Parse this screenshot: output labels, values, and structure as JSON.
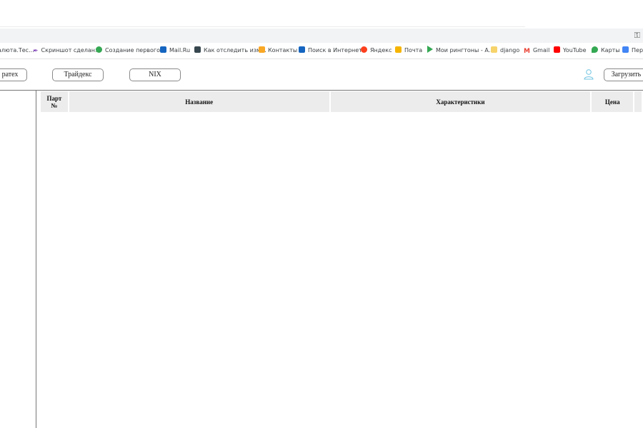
{
  "browser": {
    "bookmarks": [
      {
        "label": "алюта.Тес...",
        "icon": "generic-page-icon",
        "color": "#9aa0a6"
      },
      {
        "label": "Скриншот сделан...",
        "icon": "feather-icon",
        "color": "#7b3fb5"
      },
      {
        "label": "Создание первого...",
        "icon": "green-circle-icon",
        "color": "#34a853"
      },
      {
        "label": "Mail.Ru",
        "icon": "mail-ru-icon",
        "color": "#1565c0"
      },
      {
        "label": "Как отследить изм...",
        "icon": "image-icon",
        "color": "#37474f"
      },
      {
        "label": "Контакты",
        "icon": "contacts-icon",
        "color": "#f9a825"
      },
      {
        "label": "Поиск в Интернете",
        "icon": "mail-ru-icon",
        "color": "#1565c0"
      },
      {
        "label": "Яндекс",
        "icon": "yandex-icon",
        "color": "#fc3f1d"
      },
      {
        "label": "Почта",
        "icon": "yandex-mail-icon",
        "color": "#f5b400"
      },
      {
        "label": "Мои рингтоны - А...",
        "icon": "play-icon",
        "color": "#34a853"
      },
      {
        "label": "django",
        "icon": "folder-icon",
        "color": "#f6d36b"
      },
      {
        "label": "Gmail",
        "icon": "gmail-icon",
        "color": "#ea4335"
      },
      {
        "label": "YouTube",
        "icon": "youtube-icon",
        "color": "#ff0000"
      },
      {
        "label": "Карты",
        "icon": "maps-pin-icon",
        "color": "#34a853"
      },
      {
        "label": "Пер",
        "icon": "translate-icon",
        "color": "#4285f4"
      }
    ]
  },
  "nav": {
    "buttons": [
      {
        "label": "ратех"
      },
      {
        "label": "Трайдекс"
      },
      {
        "label": "NIX"
      }
    ],
    "upload_label": "Загрузить К"
  },
  "table": {
    "headers": [
      {
        "label": "Парт №"
      },
      {
        "label": "Название"
      },
      {
        "label": "Характеристики"
      },
      {
        "label": "Цена"
      }
    ],
    "rows": []
  },
  "colors": {
    "user_icon": "#6fc3e0",
    "header_bg": "#ececec"
  }
}
